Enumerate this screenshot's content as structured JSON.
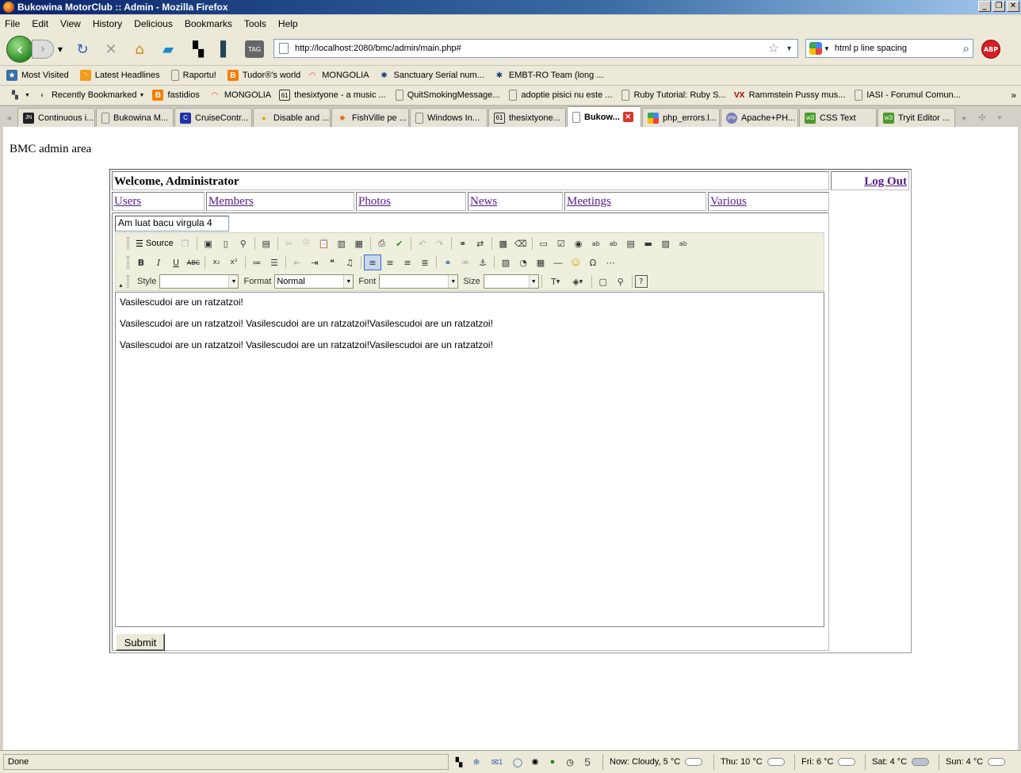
{
  "window": {
    "title": "Bukowina MotorClub :: Admin - Mozilla Firefox"
  },
  "menu": [
    "File",
    "Edit",
    "View",
    "History",
    "Delicious",
    "Bookmarks",
    "Tools",
    "Help"
  ],
  "navigation": {
    "url": "http://localhost:2080/bmc/admin/main.php#",
    "search_value": "html p line spacing",
    "abp_label": "ABP"
  },
  "bookmarks_row1": [
    {
      "label": "Most Visited",
      "icon": "most-visited-icon"
    },
    {
      "label": "Latest Headlines",
      "icon": "rss-icon"
    },
    {
      "label": "Raportu!",
      "icon": "page-icon"
    },
    {
      "label": "Tudor®'s world",
      "icon": "blogger-icon"
    },
    {
      "label": "MONGOLIA",
      "icon": "rainbow-icon"
    },
    {
      "label": "Sanctuary Serial num...",
      "icon": "sanctuary-icon"
    },
    {
      "label": "EMBT-RO Team (long ...",
      "icon": "sanctuary-icon"
    }
  ],
  "bookmarks_row2": [
    {
      "label": "Recently Bookmarked",
      "icon": "bookmark-folder-icon"
    },
    {
      "label": "fastidios",
      "icon": "blogger-icon"
    },
    {
      "label": "MONGOLIA",
      "icon": "rainbow-icon"
    },
    {
      "label": "thesixtyone - a music ...",
      "icon": "sixtyone-icon"
    },
    {
      "label": "QuitSmokingMessage...",
      "icon": "page-icon"
    },
    {
      "label": "adoptie pisici nu este ...",
      "icon": "page-icon"
    },
    {
      "label": "Ruby Tutorial: Ruby S...",
      "icon": "page-icon"
    },
    {
      "label": "Rammstein Pussy mus...",
      "icon": "vx-icon"
    },
    {
      "label": "IASI - Forumul Comun...",
      "icon": "page-icon"
    }
  ],
  "tabs": [
    {
      "label": "Continuous i...",
      "icon": "jn-icon",
      "active": false
    },
    {
      "label": "Bukowina M...",
      "icon": "page-icon",
      "active": false
    },
    {
      "label": "CruiseContr...",
      "icon": "cruise-icon",
      "active": false
    },
    {
      "label": "Disable and ...",
      "icon": "bulb-icon",
      "active": false
    },
    {
      "label": "FishVille pe ...",
      "icon": "fishville-icon",
      "active": false
    },
    {
      "label": "Windows In...",
      "icon": "page-icon",
      "active": false
    },
    {
      "label": "thesixtyone...",
      "icon": "sixtyone-icon",
      "active": false
    },
    {
      "label": "Bukow...",
      "icon": "page-icon",
      "active": true
    },
    {
      "label": "php_errors.l...",
      "icon": "google-icon",
      "active": false
    },
    {
      "label": "Apache+PH...",
      "icon": "php-icon",
      "active": false
    },
    {
      "label": "CSS Text",
      "icon": "w3-icon",
      "active": false
    },
    {
      "label": "Tryit Editor ...",
      "icon": "w3-icon",
      "active": false
    }
  ],
  "page": {
    "heading": "BMC admin area",
    "welcome": "Welcome, Administrator",
    "logout": "Log Out",
    "nav": [
      "Users",
      "Members",
      "Photos",
      "News",
      "Meetings",
      "Various"
    ],
    "title_value": "Am luat bacu virgula 4",
    "submit_label": "Submit"
  },
  "editor": {
    "source_label": "Source",
    "style_label": "Style",
    "style_value": "",
    "format_label": "Format",
    "format_value": "Normal",
    "font_label": "Font",
    "font_value": "",
    "size_label": "Size",
    "size_value": "",
    "paragraphs": [
      "Vasilescudoi are un ratzatzoi!",
      "Vasilescudoi are un ratzatzoi! Vasilescudoi are un ratzatzoi!Vasilescudoi are un ratzatzoi!",
      "Vasilescudoi are un ratzatzoi! Vasilescudoi are un ratzatzoi!Vasilescudoi are un ratzatzoi!"
    ]
  },
  "status": {
    "text": "Done",
    "mail_count": "1",
    "number": "5",
    "weather": [
      "Now: Cloudy, 5 °C",
      "Thu: 10 °C",
      "Fri: 6 °C",
      "Sat: 4 °C",
      "Sun: 4 °C"
    ]
  }
}
